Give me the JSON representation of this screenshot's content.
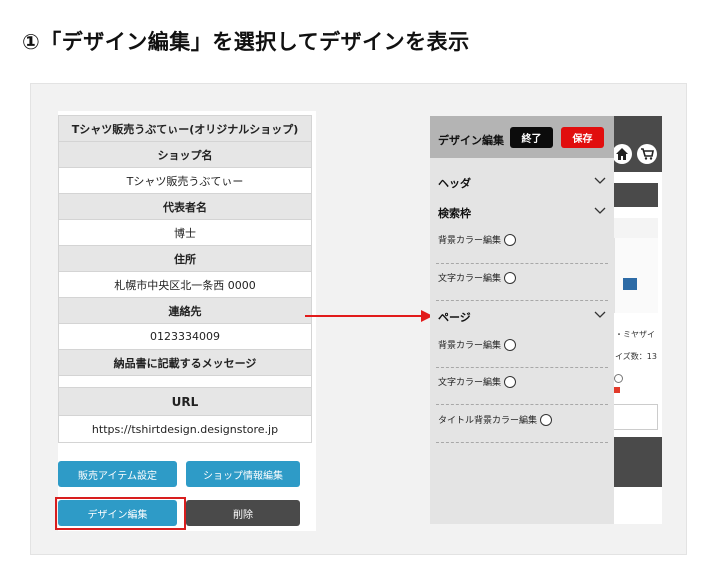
{
  "heading": "①「デザイン編集」を選択してデザインを表示",
  "shop_info": {
    "rows": [
      {
        "kind": "head",
        "text": "Tシャツ販売うぶてぃー(オリジナルショップ)"
      },
      {
        "kind": "head",
        "text": "ショップ名"
      },
      {
        "kind": "val",
        "text": "Tシャツ販売うぶてぃー"
      },
      {
        "kind": "head",
        "text": "代表者名"
      },
      {
        "kind": "val",
        "text": "博士"
      },
      {
        "kind": "head",
        "text": "住所"
      },
      {
        "kind": "val",
        "text": "札幌市中央区北一条西 0000"
      },
      {
        "kind": "head",
        "text": "連絡先"
      },
      {
        "kind": "val",
        "text": "0123334009"
      },
      {
        "kind": "head",
        "text": "納品書に記載するメッセージ"
      },
      {
        "kind": "empty",
        "text": ""
      },
      {
        "kind": "url",
        "text": "URL"
      },
      {
        "kind": "val",
        "text": "https://tshirtdesign.designstore.jp"
      }
    ],
    "buttons": {
      "sales_items": "販売アイテム設定",
      "shop_info_edit": "ショップ情報編集",
      "design_edit": "デザイン編集",
      "delete": "削除"
    }
  },
  "design_panel": {
    "title": "デザイン編集",
    "end_label": "終了",
    "save_label": "保存",
    "sections": {
      "header": "ヘッダ",
      "search": "検索枠",
      "page": "ページ"
    },
    "items": {
      "search_bg_color": "背景カラー編集",
      "search_text_color": "文字カラー編集",
      "page_bg_color": "背景カラー編集",
      "page_text_color": "文字カラー編集",
      "page_title_bg_color": "タイトル背景カラー編集"
    }
  },
  "behind_page": {
    "text_line1": "・ミヤザイ",
    "text_line2": "イズ数：13"
  },
  "colors": {
    "accent_blue": "#2e9bc7",
    "save_red": "#e10e0e",
    "arrow_red": "#e21b1b"
  }
}
